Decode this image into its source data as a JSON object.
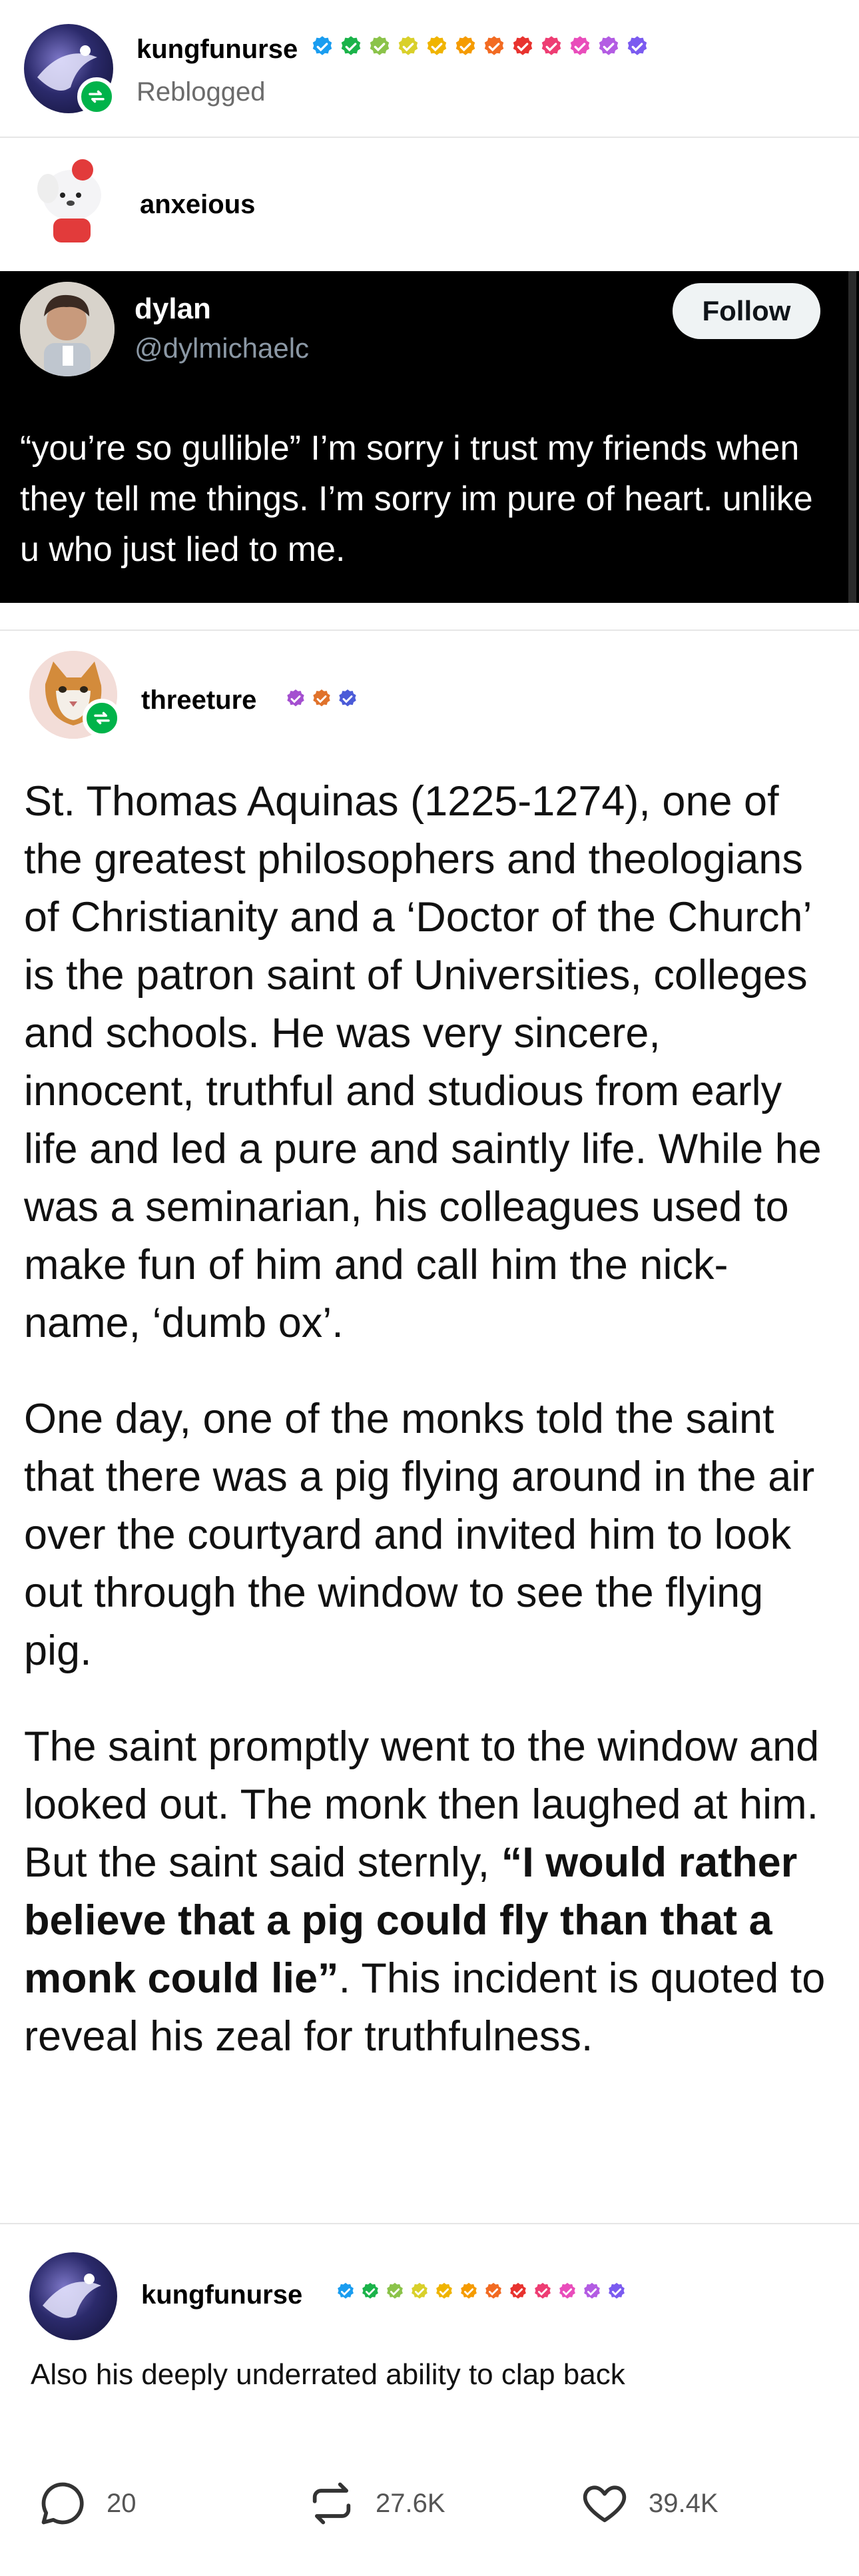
{
  "posts": {
    "reblogger": {
      "username": "kungfunurse",
      "status": "Reblogged",
      "badge_colors": [
        "#1a9df0",
        "#1bb34a",
        "#8bc34a",
        "#d9d02b",
        "#f0b400",
        "#f59b00",
        "#f26b22",
        "#e8332f",
        "#ee3d73",
        "#e94dbb",
        "#b35ce3",
        "#7b5bf0"
      ]
    },
    "anxeious": {
      "username": "anxeious"
    },
    "tweet": {
      "name": "dylan",
      "handle": "@dylmichaelc",
      "follow_label": "Follow",
      "text": "“you’re so gullible” I’m sorry i trust my friends when they tell me things. I’m sorry im pure of heart. unlike u who just lied to me."
    },
    "threeture": {
      "username": "threeture",
      "badge_colors": [
        "#a44fd0",
        "#e0722b",
        "#4b5bd8"
      ],
      "paragraph1": "St. Thomas Aquinas (1225-1274), one of the greatest philosophers and theologians of Christianity and a ‘Doctor of the Church’ is the patron saint of Universities, colleges and schools. He was very sincere, innocent, truthful and studious from early life and led a pure and saintly life. While he was a seminarian, his colleagues used to make fun of him and call him the nick-name, ‘dumb ox’.",
      "paragraph2": "One day, one of the monks told the saint that there was a pig flying around in the air over the courtyard and invited him to look out through the window to see the flying pig.",
      "paragraph3_before": "The saint promptly went to the window and looked out. The monk then laughed at him. But the saint said sternly, ",
      "paragraph3_bold": "“I would rather believe that a pig could fly than that a monk could lie”",
      "paragraph3_after": ". This incident is quoted to reveal his zeal for truthfulness."
    },
    "final_reblog": {
      "username": "kungfunurse",
      "text": "Also his deeply underrated ability to clap back"
    }
  },
  "actions": {
    "replies": "20",
    "reblogs": "27.6K",
    "likes": "39.4K"
  },
  "colors": {
    "reblog_green": "#00b34a",
    "tweet_bg": "#000000",
    "muted_text": "#6b6b6b"
  }
}
